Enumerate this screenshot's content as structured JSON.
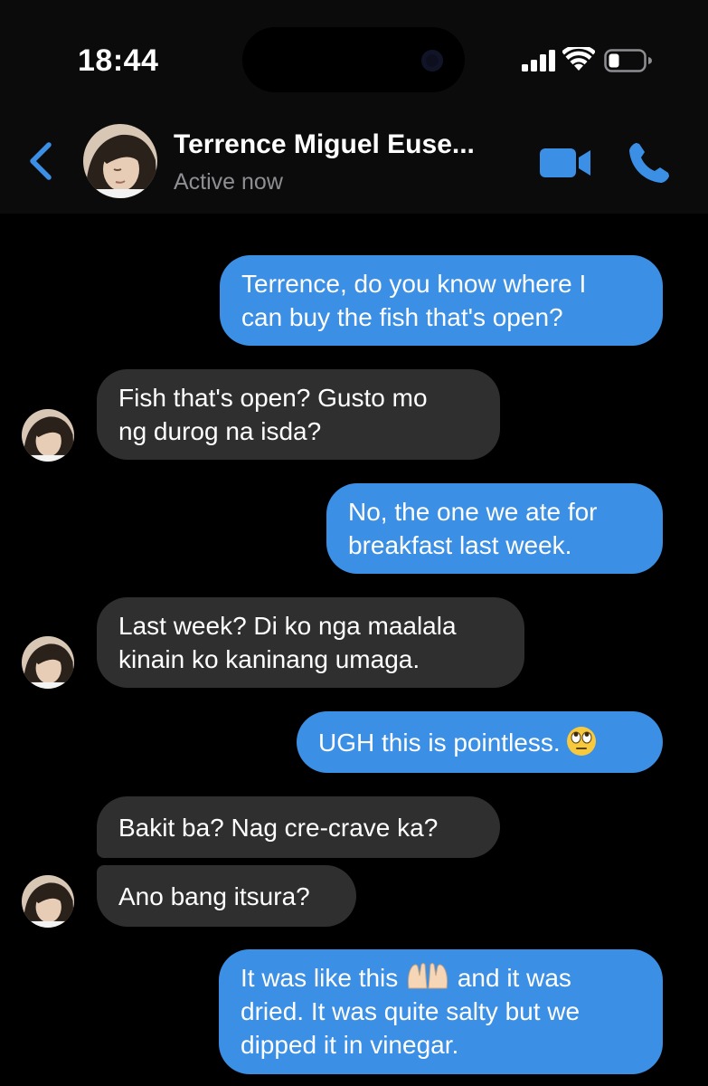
{
  "status_bar": {
    "time": "18:44"
  },
  "header": {
    "contact_name": "Terrence Miguel Euse...",
    "status": "Active now",
    "accent_color": "#3b8fe4"
  },
  "messages": [
    {
      "direction": "out",
      "text_lines": [
        "Terrence, do you know where I",
        "can buy the fish that's open?"
      ]
    },
    {
      "direction": "in",
      "text_lines": [
        "Fish that's open? Gusto mo",
        "ng durog na isda?"
      ]
    },
    {
      "direction": "out",
      "text_lines": [
        "No, the one we ate for",
        "breakfast last week."
      ]
    },
    {
      "direction": "in",
      "text_lines": [
        "Last week? Di ko nga maalala",
        "kinain ko kaninang umaga."
      ]
    },
    {
      "direction": "out",
      "text": "UGH this is pointless.",
      "emoji": "face-with-rolling-eyes-icon"
    },
    {
      "direction": "in",
      "text": "Bakit ba? Nag cre-crave ka?"
    },
    {
      "direction": "in",
      "text": "Ano bang itsura?"
    },
    {
      "direction": "out",
      "text_parts": [
        "It was like this",
        "and it was"
      ],
      "emoji": "palms-up-together-icon",
      "text_lines": [
        "dried. It was quite salty but we",
        "dipped it in vinegar."
      ]
    }
  ]
}
